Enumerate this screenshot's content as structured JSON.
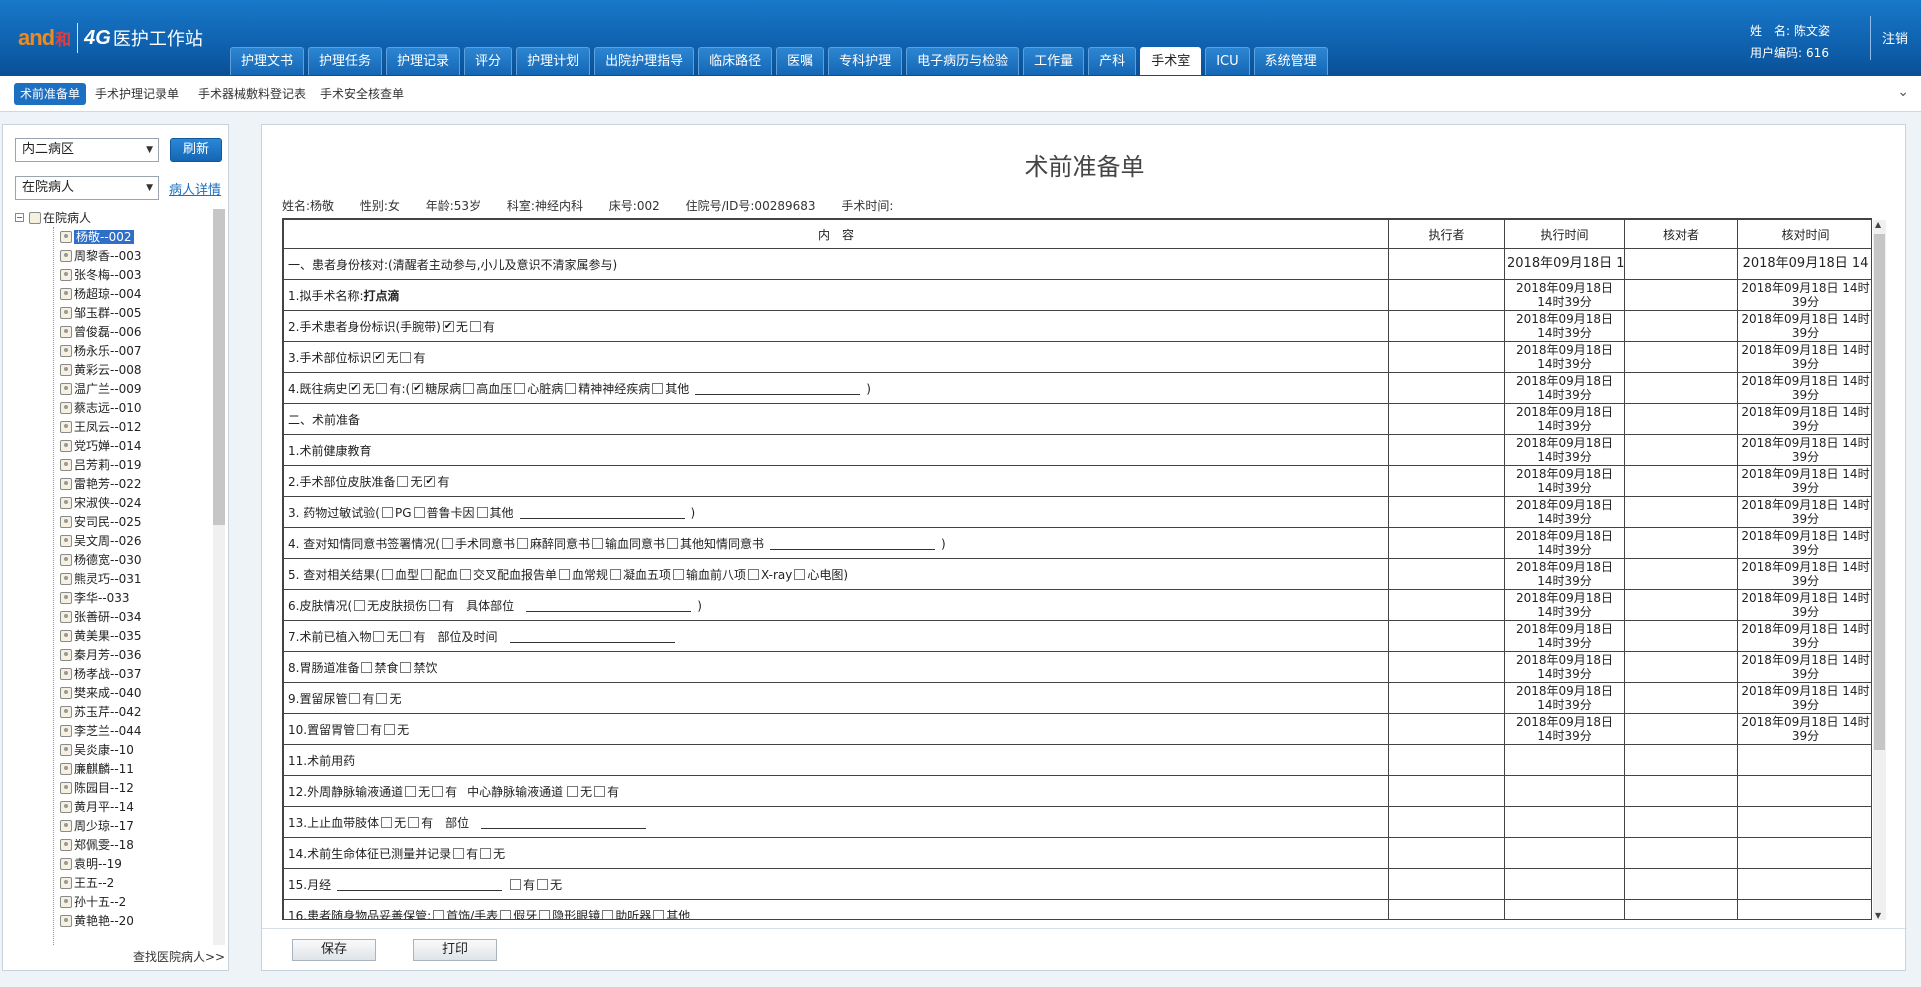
{
  "header": {
    "logo_and": "and",
    "logo_he": "和",
    "logo_4g": "4G",
    "app_title": "医护工作站",
    "nav_tabs": [
      {
        "label": "护理文书"
      },
      {
        "label": "护理任务"
      },
      {
        "label": "护理记录"
      },
      {
        "label": "评分"
      },
      {
        "label": "护理计划"
      },
      {
        "label": "出院护理指导"
      },
      {
        "label": "临床路径"
      },
      {
        "label": "医嘱"
      },
      {
        "label": "专科护理"
      },
      {
        "label": "电子病历与检验"
      },
      {
        "label": "工作量"
      },
      {
        "label": "产科"
      },
      {
        "label": "手术室"
      },
      {
        "label": "ICU"
      },
      {
        "label": "系统管理"
      }
    ],
    "active_tab": "手术室",
    "user_name_label": "姓　名:",
    "user_name": "陈文姿",
    "user_code_label": "用户编码:",
    "user_code": "616",
    "logout": "注销"
  },
  "subnav": {
    "tabs": [
      "术前准备单",
      "手术护理记录单",
      "手术器械敷料登记表",
      "手术安全核查单"
    ],
    "active": "术前准备单"
  },
  "left": {
    "ward_select": "内二病区",
    "refresh": "刷新",
    "status_select": "在院病人",
    "detail_link": "病人详情",
    "tree_root": "在院病人",
    "patients": [
      "杨敬--002",
      "周黎香--003",
      "张冬梅--003",
      "杨超琼--004",
      "邹玉群--005",
      "曾俊磊--006",
      "杨永乐--007",
      "黄彩云--008",
      "温广兰--009",
      "蔡志远--010",
      "王凤云--012",
      "党巧婵--014",
      "吕芳莉--019",
      "雷艳芳--022",
      "宋淑侠--024",
      "安司民--025",
      "吴文周--026",
      "杨德宽--030",
      "熊灵巧--031",
      "李华--033",
      "张善研--034",
      "黄美果--035",
      "秦月芳--036",
      "杨孝战--037",
      "樊来成--040",
      "苏玉芹--042",
      "李芝兰--044",
      "吴炎康--10",
      "廉麒麟--11",
      "陈园目--12",
      "黄月平--14",
      "周少琼--17",
      "郑佩雯--18",
      "袁明--19",
      "王五--2",
      "孙十五--2",
      "黄艳艳--20"
    ],
    "selected_patient": "杨敬--002",
    "search_link": "查找医院病人>>"
  },
  "form": {
    "title": "术前准备单",
    "patient_info": {
      "name": "姓名:杨敬",
      "sex": "性别:女",
      "age": "年龄:53岁",
      "dept": "科室:神经内科",
      "bed": "床号:002",
      "admission": "住院号/ID号:00289683",
      "surgery_time": "手术时间:"
    },
    "columns": [
      "内　容",
      "执行者",
      "执行时间",
      "核对者",
      "核对时间"
    ],
    "exec_time_first": "2018年09月18日 14",
    "exec_time": "2018年09月18日 14时39分",
    "rows": [
      {
        "text": "一、患者身份核对:(清醒者主动参与,小儿及意识不清家属参与)"
      },
      {
        "text": "1.拟手术名称:",
        "value": "打点滴"
      },
      {
        "text": "2.手术患者身份标识(手腕带)",
        "opts": [
          {
            "l": "无",
            "on": true
          },
          {
            "l": "有",
            "on": false
          }
        ]
      },
      {
        "text": "3.手术部位标识",
        "opts": [
          {
            "l": "无",
            "on": true
          },
          {
            "l": "有",
            "on": false
          }
        ]
      },
      {
        "text": "4.既往病史",
        "opts": [
          {
            "l": "无",
            "on": true
          },
          {
            "l": "有:(",
            "on": false
          },
          {
            "l": "糖尿病",
            "on": true
          },
          {
            "l": "高血压",
            "on": false
          },
          {
            "l": "心脏病",
            "on": false
          },
          {
            "l": "精神神经疾病",
            "on": false
          },
          {
            "l": "其他",
            "on": false
          }
        ],
        "line": true,
        "tail": ")"
      },
      {
        "text": "二、术前准备"
      },
      {
        "text": "1.术前健康教育"
      },
      {
        "text": "2.手术部位皮肤准备",
        "opts": [
          {
            "l": "无",
            "on": false
          },
          {
            "l": "有",
            "on": true
          }
        ]
      },
      {
        "text": "3. 药物过敏试验(",
        "opts": [
          {
            "l": "PG",
            "on": false
          },
          {
            "l": "普鲁卡因",
            "on": false
          },
          {
            "l": "其他",
            "on": false
          }
        ],
        "line": true,
        "tail": ")"
      },
      {
        "text": "4. 查对知情同意书签署情况(",
        "opts": [
          {
            "l": "手术同意书",
            "on": false
          },
          {
            "l": "麻醉同意书",
            "on": false
          },
          {
            "l": "输血同意书",
            "on": false
          },
          {
            "l": "其他知情同意书",
            "on": false
          }
        ],
        "line": true,
        "tail": ")"
      },
      {
        "text": "5. 查对相关结果(",
        "opts": [
          {
            "l": "血型",
            "on": false
          },
          {
            "l": "配血",
            "on": false
          },
          {
            "l": "交叉配血报告单",
            "on": false
          },
          {
            "l": "血常规",
            "on": false
          },
          {
            "l": "凝血五项",
            "on": false
          },
          {
            "l": "输血前八项",
            "on": false
          },
          {
            "l": "X-ray",
            "on": false
          },
          {
            "l": "心电图",
            "on": false
          }
        ],
        "tail": ")"
      },
      {
        "text": "6.皮肤情况(",
        "opts": [
          {
            "l": "无皮肤损伤",
            "on": false
          },
          {
            "l": "有",
            "on": false
          }
        ],
        "mid": "具体部位",
        "line": true,
        "tail": ")"
      },
      {
        "text": "7.术前已植入物",
        "opts": [
          {
            "l": "无",
            "on": false
          },
          {
            "l": "有",
            "on": false
          }
        ],
        "mid": "部位及时间",
        "line": true
      },
      {
        "text": "8.胃肠道准备",
        "opts": [
          {
            "l": "禁食",
            "on": false
          },
          {
            "l": "禁饮",
            "on": false
          }
        ]
      },
      {
        "text": "9.置留尿管",
        "opts": [
          {
            "l": "有",
            "on": false
          },
          {
            "l": "无",
            "on": false
          }
        ]
      },
      {
        "text": "10.置留胃管",
        "opts": [
          {
            "l": "有",
            "on": false
          },
          {
            "l": "无",
            "on": false
          }
        ]
      },
      {
        "text": "11.术前用药"
      },
      {
        "text": "12.外周静脉输液通道",
        "opts": [
          {
            "l": "无",
            "on": false
          },
          {
            "l": "有",
            "on": false
          }
        ],
        "mid2": "中心静脉输液通道",
        "opts2": [
          {
            "l": "无",
            "on": false
          },
          {
            "l": "有",
            "on": false
          }
        ]
      },
      {
        "text": "13.上止血带肢体",
        "opts": [
          {
            "l": "无",
            "on": false
          },
          {
            "l": "有",
            "on": false
          }
        ],
        "mid": "部位",
        "line": true
      },
      {
        "text": "14.术前生命体征已测量并记录",
        "opts": [
          {
            "l": "有",
            "on": false
          },
          {
            "l": "无",
            "on": false
          }
        ]
      },
      {
        "text": "15.月经",
        "line_first": true,
        "opts": [
          {
            "l": "有",
            "on": false
          },
          {
            "l": "无",
            "on": false
          }
        ]
      },
      {
        "text": "16.患者随身物品妥善保管:",
        "opts": [
          {
            "l": "首饰/手表",
            "on": false
          },
          {
            "l": "假牙",
            "on": false
          },
          {
            "l": "隐形眼镜",
            "on": false
          },
          {
            "l": "助听器",
            "on": false
          },
          {
            "l": "其他",
            "on": false
          }
        ],
        "line": true
      }
    ],
    "save": "保存",
    "print": "打印"
  }
}
